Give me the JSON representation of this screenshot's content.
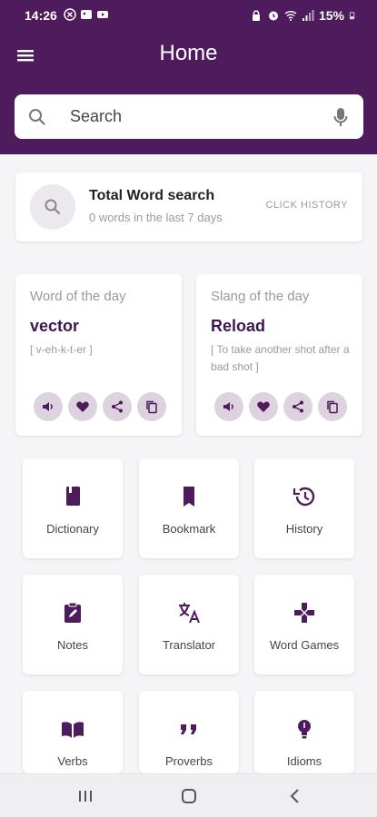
{
  "status_bar": {
    "time": "14:26",
    "battery": "15%"
  },
  "app_bar": {
    "title": "Home"
  },
  "search": {
    "placeholder": "Search"
  },
  "total_search": {
    "title": "Total Word search",
    "subtitle": "0 words in the last 7 days",
    "link": "CLICK HISTORY"
  },
  "word_of_day": {
    "label": "Word of the day",
    "word": "vector",
    "phonetic": "[ v-eh-k-t-er ]"
  },
  "slang_of_day": {
    "label": "Slang of the day",
    "word": "Reload",
    "meaning": "[ To take another shot after a bad shot ]"
  },
  "tiles": [
    {
      "label": "Dictionary",
      "icon": "book-icon"
    },
    {
      "label": "Bookmark",
      "icon": "bookmark-icon"
    },
    {
      "label": "History",
      "icon": "history-icon"
    },
    {
      "label": "Notes",
      "icon": "notes-icon"
    },
    {
      "label": "Translator",
      "icon": "translate-icon"
    },
    {
      "label": "Word Games",
      "icon": "gamepad-icon"
    },
    {
      "label": "Verbs",
      "icon": "open-book-icon"
    },
    {
      "label": "Proverbs",
      "icon": "quote-icon"
    },
    {
      "label": "Idioms",
      "icon": "lightbulb-icon"
    }
  ],
  "colors": {
    "brand": "#4e1b5c",
    "accent_icon": "#4e1b5c",
    "action_bg": "#ddd3df"
  }
}
